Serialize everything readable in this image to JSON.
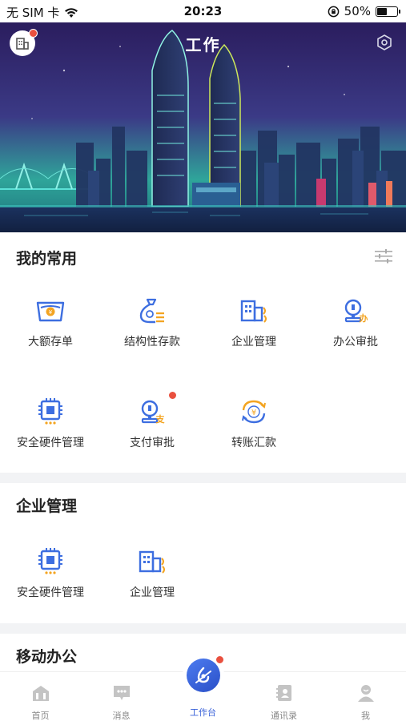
{
  "status": {
    "carrier": "无 SIM 卡",
    "time": "20:23",
    "battery": "50%",
    "battery_level": 0.5
  },
  "header": {
    "title": "工作"
  },
  "sections": {
    "favorites": {
      "title": "我的常用",
      "items": [
        {
          "label": "大额存单",
          "icon": "deposit-basket-icon"
        },
        {
          "label": "结构性存款",
          "icon": "money-bag-icon"
        },
        {
          "label": "企业管理",
          "icon": "enterprise-building-icon"
        },
        {
          "label": "办公审批",
          "icon": "office-approval-icon"
        },
        {
          "label": "安全硬件管理",
          "icon": "security-chip-icon"
        },
        {
          "label": "支付审批",
          "icon": "payment-approval-icon"
        },
        {
          "label": "转账汇款",
          "icon": "transfer-icon"
        }
      ]
    },
    "enterprise": {
      "title": "企业管理",
      "items": [
        {
          "label": "安全硬件管理",
          "icon": "security-chip-icon"
        },
        {
          "label": "企业管理",
          "icon": "enterprise-building-icon"
        }
      ]
    },
    "mobile": {
      "title": "移动办公"
    }
  },
  "tabs": [
    {
      "label": "首页",
      "icon": "home-icon"
    },
    {
      "label": "消息",
      "icon": "message-icon"
    },
    {
      "label": "工作台",
      "icon": "workbench-icon",
      "active": true
    },
    {
      "label": "通讯录",
      "icon": "contacts-icon"
    },
    {
      "label": "我",
      "icon": "profile-icon"
    }
  ],
  "colors": {
    "accent": "#3a62d9",
    "icon_blue": "#3d6ee0",
    "icon_orange": "#f3a421",
    "badge": "#e9503f"
  }
}
